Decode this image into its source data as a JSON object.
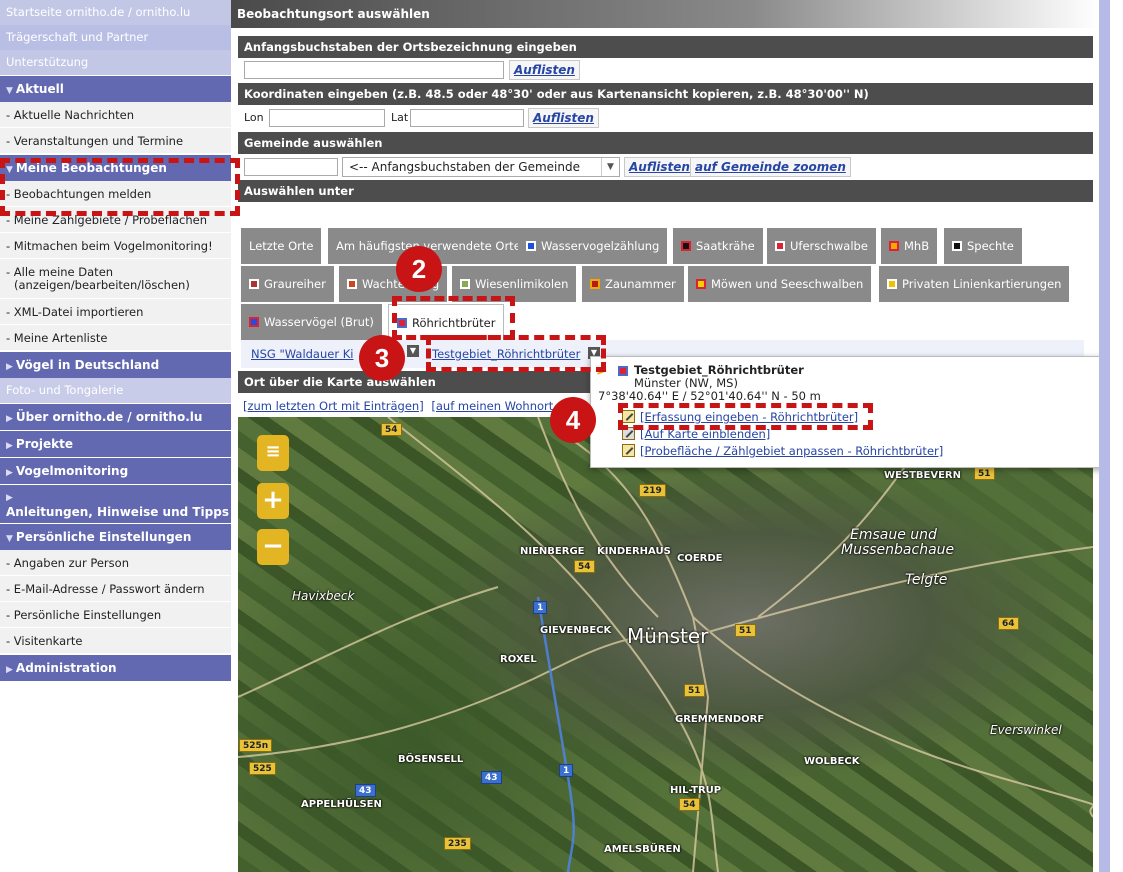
{
  "sidebar": {
    "top_links": [
      "Startseite ornitho.de / ornitho.lu",
      "Trägerschaft und Partner",
      "Unterstützung"
    ],
    "aktuell": {
      "header": "Aktuell",
      "items": [
        "- Aktuelle Nachrichten",
        "- Veranstaltungen und Termine"
      ]
    },
    "meine": {
      "header": "Meine Beobachtungen",
      "items": [
        "- Beobachtungen melden",
        "- Meine Zählgebiete / Probeflächen",
        "- Mitmachen beim Vogelmonitoring!",
        "- Alle meine Daten",
        "(anzeigen/bearbeiten/löschen)",
        "- XML-Datei importieren",
        "- Meine Artenliste"
      ]
    },
    "voegel_header": "Vögel in Deutschland",
    "foto": "Foto- und Tongalerie",
    "ueber_header": "Über ornitho.de / ornitho.lu",
    "projekte_header": "Projekte",
    "vogelmon_header": "Vogelmonitoring",
    "anleitungen_header": "Anleitungen, Hinweise und Tipps",
    "pers": {
      "header": "Persönliche Einstellungen",
      "items": [
        "- Angaben zur Person",
        "- E-Mail-Adresse / Passwort ändern",
        "- Persönliche Einstellungen",
        "- Visitenkarte"
      ]
    },
    "admin_header": "Administration"
  },
  "main": {
    "title": "Beobachtungsort auswählen",
    "sect1": "Anfangsbuchstaben der Ortsbezeichnung eingeben",
    "sect2": "Koordinaten eingeben (z.B. 48.5 oder 48°30' oder aus Kartenansicht kopieren, z.B. 48°30'00'' N)",
    "sect3": "Gemeinde auswählen",
    "sect4": "Auswählen unter",
    "auflisten": "Auflisten",
    "lon": "Lon",
    "lat": "Lat",
    "gemeinde_select": "<-- Anfangsbuchstaben der Gemeinde",
    "auf_gemeinde": "auf Gemeinde zoomen",
    "tabs": [
      "Letzte Orte",
      "Am häufigsten verwendete Orte",
      "Wasservogelzählung",
      "Saatkrähe",
      "Uferschwalbe",
      "MhB",
      "Spechte",
      "Graureiher",
      "Wachtelkönig",
      "Wiesenlimikolen",
      "Zaunammer",
      "Möwen und Seeschwalben",
      "Privaten Linienkartierungen",
      "Wasservögel (Brut)",
      "Röhrichtbrüter"
    ],
    "breadcrumb": {
      "first": "NSG \"Waldauer Ki",
      "second": "Testgebiet_Röhrichtbrüter"
    },
    "map_title": "Ort über die Karte auswählen",
    "map_links": [
      "[zum letzten Ort mit Einträgen]",
      "[auf meinen Wohnort z"
    ]
  },
  "popup": {
    "title": "Testgebiet_Röhrichtbrüter",
    "subtitle": "Münster (NW, MS)",
    "coords": "7°38'40.64'' E / 52°01'40.64'' N - 50 m",
    "links": [
      "[Erfassung eingeben - Röhrichtbrüter]",
      "[Auf Karte einblenden]",
      "[Probefläche / Zählgebiet anpassen - Röhrichtbrüter]"
    ],
    "close": "x"
  },
  "map": {
    "places": [
      "WESTBEVERN",
      "Emsaue und",
      "Mussenbachaue",
      "Telgte",
      "NIENBERGE",
      "KINDERHAUS",
      "COERDE",
      "Havixbeck",
      "GIEVENBECK",
      "Münster",
      "ROXEL",
      "GREMMENDORF",
      "Everswinkel",
      "BÖSENSELL",
      "WOLBECK",
      "HIL-TRUP",
      "APPELHÜLSEN",
      "AMELSBÜREN"
    ],
    "shields": [
      "54",
      "219",
      "51",
      "54",
      "1",
      "51",
      "64",
      "51",
      "525n",
      "525",
      "43",
      "43",
      "1",
      "54",
      "235"
    ]
  },
  "annotations": [
    "2",
    "3",
    "4"
  ],
  "colors": {
    "accent": "#6269b0",
    "annotation": "#c81414",
    "link": "#2645a4"
  }
}
